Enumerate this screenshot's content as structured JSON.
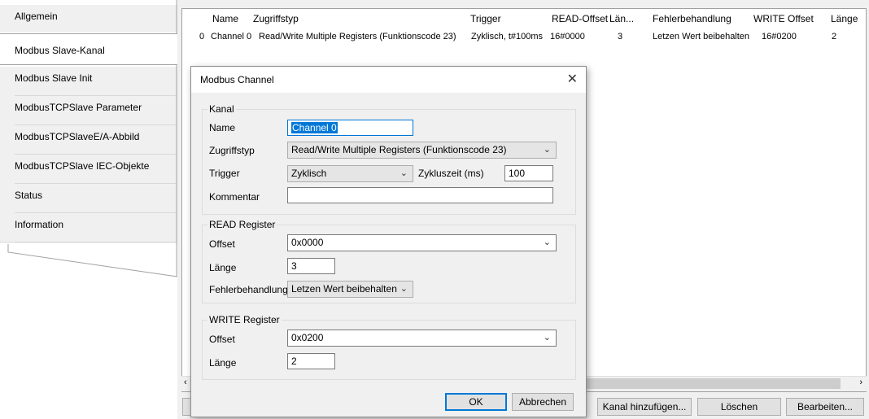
{
  "sidebar": {
    "items": [
      {
        "label": "Allgemein"
      },
      {
        "label": "Modbus Slave-Kanal"
      },
      {
        "label": "Modbus Slave Init"
      },
      {
        "label": "ModbusTCPSlave Parameter"
      },
      {
        "label": "ModbusTCPSlaveE/A-Abbild"
      },
      {
        "label": "ModbusTCPSlave IEC-Objekte"
      },
      {
        "label": "Status"
      },
      {
        "label": "Information"
      }
    ]
  },
  "grid": {
    "headers": [
      "Name",
      "Zugriffstyp",
      "Trigger",
      "READ-Offset",
      "Län...",
      "Fehlerbehandlung",
      "WRITE Offset",
      "Länge"
    ],
    "row": {
      "index": "0",
      "name": "Channel 0",
      "access": "Read/Write Multiple Registers (Funktionscode 23)",
      "trigger": "Zyklisch, t#100ms",
      "read_offset": "16#0000",
      "read_len": "3",
      "error": "Letzen Wert beibehalten",
      "write_offset": "16#0200",
      "write_len": "2"
    }
  },
  "buttons": {
    "add": "Kanal hinzufügen...",
    "delete": "Löschen",
    "edit": "Bearbeiten..."
  },
  "dialog": {
    "title": "Modbus Channel",
    "kanal": {
      "group": "Kanal",
      "name_label": "Name",
      "name_value": "Channel 0",
      "access_label": "Zugriffstyp",
      "access_value": "Read/Write Multiple Registers (Funktionscode 23)",
      "trigger_label": "Trigger",
      "trigger_value": "Zyklisch",
      "cycle_label": "Zykluszeit (ms)",
      "cycle_value": "100",
      "comment_label": "Kommentar",
      "comment_value": ""
    },
    "read": {
      "group": "READ Register",
      "offset_label": "Offset",
      "offset_value": "0x0000",
      "length_label": "Länge",
      "length_value": "3",
      "error_label": "Fehlerbehandlung",
      "error_value": "Letzen Wert beibehalten"
    },
    "write": {
      "group": "WRITE Register",
      "offset_label": "Offset",
      "offset_value": "0x0200",
      "length_label": "Länge",
      "length_value": "2"
    },
    "ok": "OK",
    "cancel": "Abbrechen"
  },
  "colors": {
    "accent": "#0078d7",
    "background": "#f0f0f0"
  }
}
